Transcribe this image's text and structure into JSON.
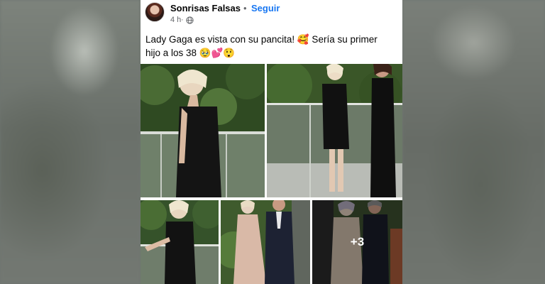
{
  "post": {
    "author": "Sonrisas Falsas",
    "separator": "•",
    "follow_label": "Seguir",
    "time": "4 h",
    "meta_sep": "·",
    "caption": "Lady Gaga es vista con su pancita! 🥰 Sería su primer hijo a los 38 🥹💕😲"
  },
  "gallery": {
    "more_count": "+3"
  },
  "colors": {
    "accent": "#1877f2",
    "text": "#050505",
    "muted": "#65676b"
  },
  "icons": {
    "globe": "globe-icon",
    "avatar": "avatar"
  }
}
